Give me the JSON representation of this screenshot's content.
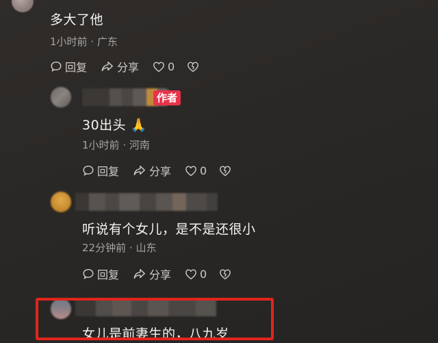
{
  "comments": [
    {
      "text": "多大了他",
      "time": "1小时前",
      "location": "广东",
      "reply_label": "回复",
      "share_label": "分享",
      "like_count": "0"
    },
    {
      "author_badge": "作者",
      "text": "30出头 🙏",
      "time": "1小时前",
      "location": "河南",
      "reply_label": "回复",
      "share_label": "分享",
      "like_count": "0"
    },
    {
      "text": "听说有个女儿，是不是还很小",
      "time": "22分钟前",
      "location": "山东",
      "reply_label": "回复",
      "share_label": "分享",
      "like_count": "0"
    },
    {
      "text": "女儿是前妻生的，八九岁"
    }
  ],
  "meta_separator": "·",
  "colors": {
    "background": "#2a2826",
    "author_badge": "#e8334a",
    "highlight": "#e2241c",
    "meta_text": "#a7a39f"
  },
  "icons": {
    "reply": "comment-bubble-icon",
    "share": "share-arrow-icon",
    "like": "heart-icon",
    "dislike": "broken-heart-icon"
  }
}
